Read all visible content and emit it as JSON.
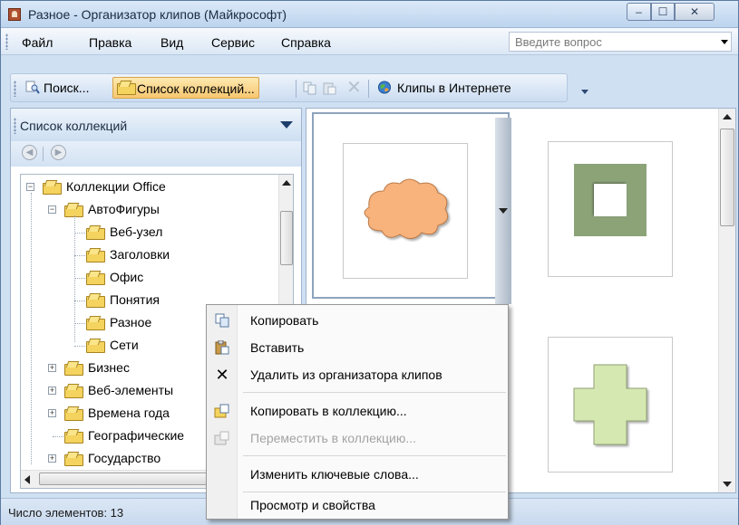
{
  "window": {
    "title": "Разное - Организатор клипов (Майкрософт)",
    "controls": {
      "minimize": "–",
      "maximize": "☐",
      "close": "✕"
    }
  },
  "menubar": {
    "items": [
      {
        "id": "file",
        "label": "Файл",
        "underline": "Ф"
      },
      {
        "id": "edit",
        "label": "Правка",
        "underline": "П"
      },
      {
        "id": "view",
        "label": "Вид",
        "underline": "В"
      },
      {
        "id": "service",
        "label": "Сервис",
        "underline": "е"
      },
      {
        "id": "help",
        "label": "Справка",
        "underline": "С"
      }
    ],
    "ask_placeholder": "Введите вопрос"
  },
  "toolbar": {
    "search_label": "Поиск...",
    "collections_label": "Список коллекций...",
    "online_label": "Клипы в Интернете",
    "icons": [
      "search-icon",
      "folder-icon",
      "copy-icon",
      "paste-icon",
      "delete-icon",
      "globe-icon"
    ]
  },
  "left_pane": {
    "title": "Список коллекций",
    "tree": [
      {
        "label": "Коллекции Office",
        "level": 0,
        "expander": "−"
      },
      {
        "label": "АвтоФигуры",
        "level": 1,
        "expander": "−"
      },
      {
        "label": "Веб-узел",
        "level": 2
      },
      {
        "label": "Заголовки",
        "level": 2
      },
      {
        "label": "Офис",
        "level": 2
      },
      {
        "label": "Понятия",
        "level": 2
      },
      {
        "label": "Разное",
        "level": 2,
        "selected": true
      },
      {
        "label": "Сети",
        "level": 2
      },
      {
        "label": "Бизнес",
        "level": 1,
        "expander": "+"
      },
      {
        "label": "Веб-элементы",
        "level": 1,
        "expander": "+"
      },
      {
        "label": "Времена года",
        "level": 1,
        "expander": "+"
      },
      {
        "label": "Географические",
        "level": 1
      },
      {
        "label": "Государство",
        "level": 1,
        "expander": "+"
      }
    ]
  },
  "clips": [
    {
      "name": "cloud-clip",
      "color": "#f8b27c"
    },
    {
      "name": "frame-clip",
      "color": "#8ca378"
    },
    {
      "name": "cross-clip",
      "color": "#d6e8b2"
    }
  ],
  "context_menu": {
    "items": [
      {
        "label": "Копировать",
        "icon": "copy-icon",
        "enabled": true
      },
      {
        "label": "Вставить",
        "icon": "paste-icon",
        "enabled": true
      },
      {
        "label": "Удалить из организатора клипов",
        "icon": "delete-icon",
        "enabled": true
      },
      {
        "label": "Копировать в коллекцию...",
        "icon": "copy-to-collection-icon",
        "enabled": true
      },
      {
        "label": "Переместить в коллекцию...",
        "icon": "move-to-collection-icon",
        "enabled": false
      },
      {
        "label": "Изменить ключевые слова...",
        "icon": "",
        "enabled": true
      },
      {
        "label": "Просмотр и свойства",
        "icon": "",
        "enabled": true
      }
    ]
  },
  "status": {
    "text": "Число элементов: 13"
  }
}
